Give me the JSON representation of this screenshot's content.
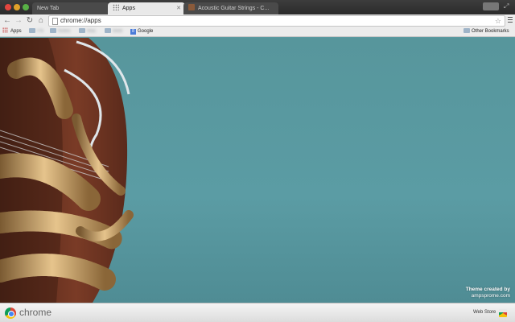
{
  "tabs": [
    {
      "label": "New Tab",
      "active": false
    },
    {
      "label": "Apps",
      "active": true
    },
    {
      "label": "Acoustic Guitar Strings - C...",
      "active": false
    }
  ],
  "toolbar": {
    "url": "chrome://apps"
  },
  "bookmarks": {
    "apps_label": "Apps",
    "items": [
      "FN",
      "Notes",
      "Mac",
      "Web",
      "Google"
    ],
    "other_label": "Other Bookmarks"
  },
  "content": {
    "credit_line1": "Theme created by",
    "credit_line2": "ampsprome.com"
  },
  "bottom": {
    "brand": "chrome",
    "webstore_label": "Web Store"
  },
  "colors": {
    "background": "#5a9aa1",
    "guitar_body": "#7a3b26",
    "spring": "#c9a46a"
  }
}
